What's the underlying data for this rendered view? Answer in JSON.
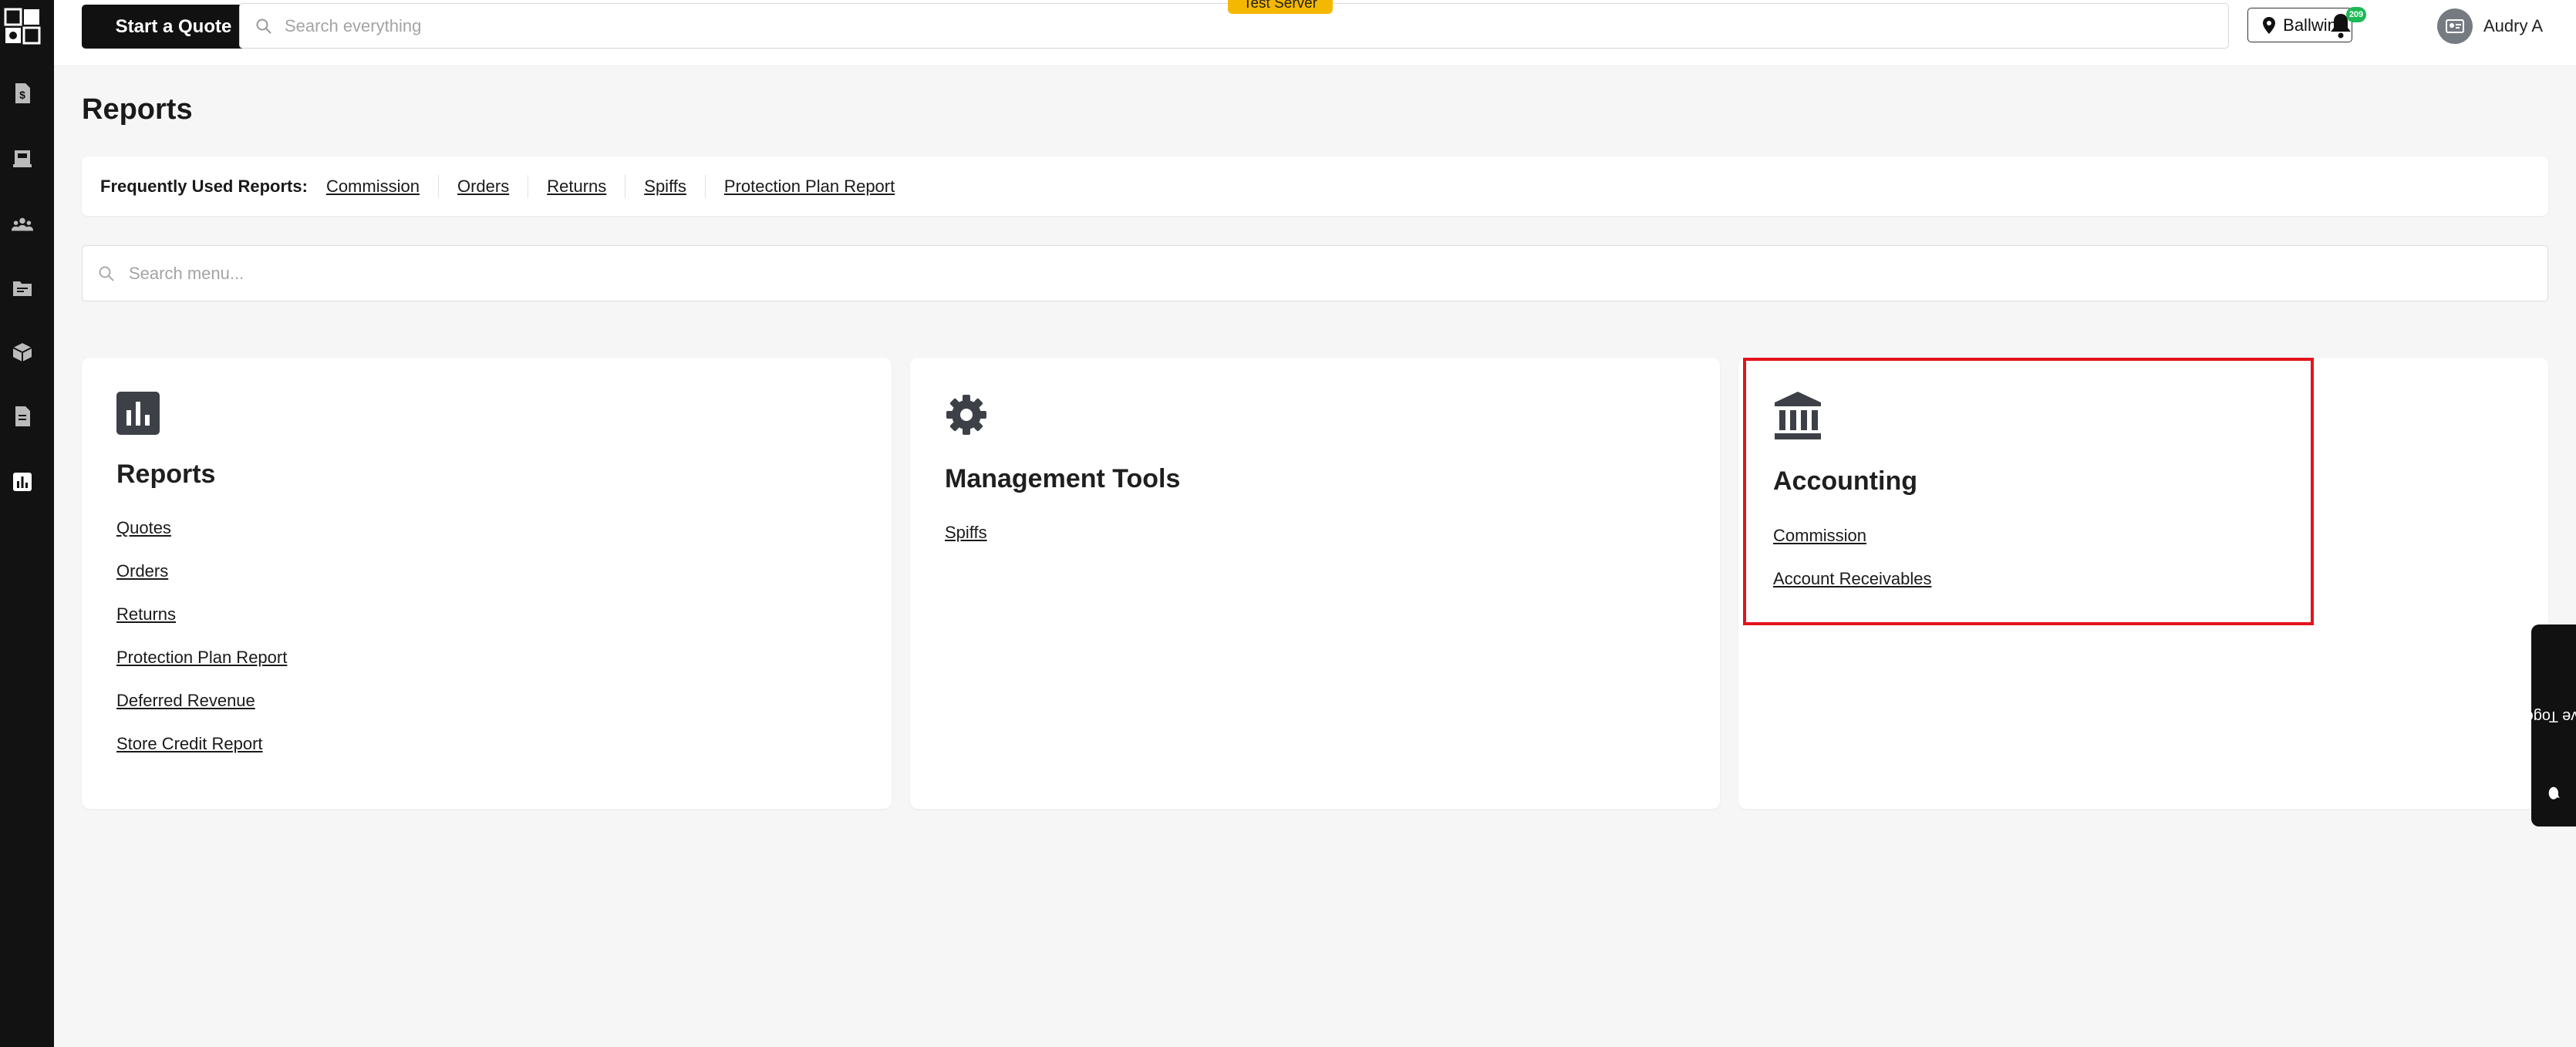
{
  "topbar": {
    "start_quote_label": "Start a Quote",
    "search_placeholder": "Search everything",
    "test_server_badge": "Test Server",
    "location_label": "Ballwin",
    "notification_count": "209",
    "user_name": "Audry A"
  },
  "sidebar": {
    "items": [
      {
        "icon": "dollar-document-icon"
      },
      {
        "icon": "register-icon"
      },
      {
        "icon": "customers-icon"
      },
      {
        "icon": "folder-icon"
      },
      {
        "icon": "box-icon"
      },
      {
        "icon": "document-icon"
      },
      {
        "icon": "reports-chart-icon",
        "active": true
      }
    ]
  },
  "page": {
    "title": "Reports"
  },
  "frequently_used": {
    "label": "Frequently Used Reports:",
    "links": [
      "Commission",
      "Orders",
      "Returns",
      "Spiffs",
      "Protection Plan Report"
    ]
  },
  "menu_search": {
    "placeholder": "Search menu..."
  },
  "cards": [
    {
      "title": "Reports",
      "icon": "bar-chart-icon",
      "links": [
        "Quotes",
        "Orders",
        "Returns",
        "Protection Plan Report",
        "Deferred Revenue",
        "Store Credit Report"
      ]
    },
    {
      "title": "Management Tools",
      "icon": "gear-icon",
      "links": [
        "Spiffs"
      ]
    },
    {
      "title": "Accounting",
      "icon": "bank-icon",
      "links": [
        "Commission",
        "Account Receivables"
      ]
    }
  ],
  "feedback_tab": {
    "label": "Improve Together !"
  },
  "colors": {
    "sidebar_bg": "#121212",
    "test_badge": "#f5b800",
    "notification_badge": "#1db954",
    "highlight": "#e4131c"
  }
}
